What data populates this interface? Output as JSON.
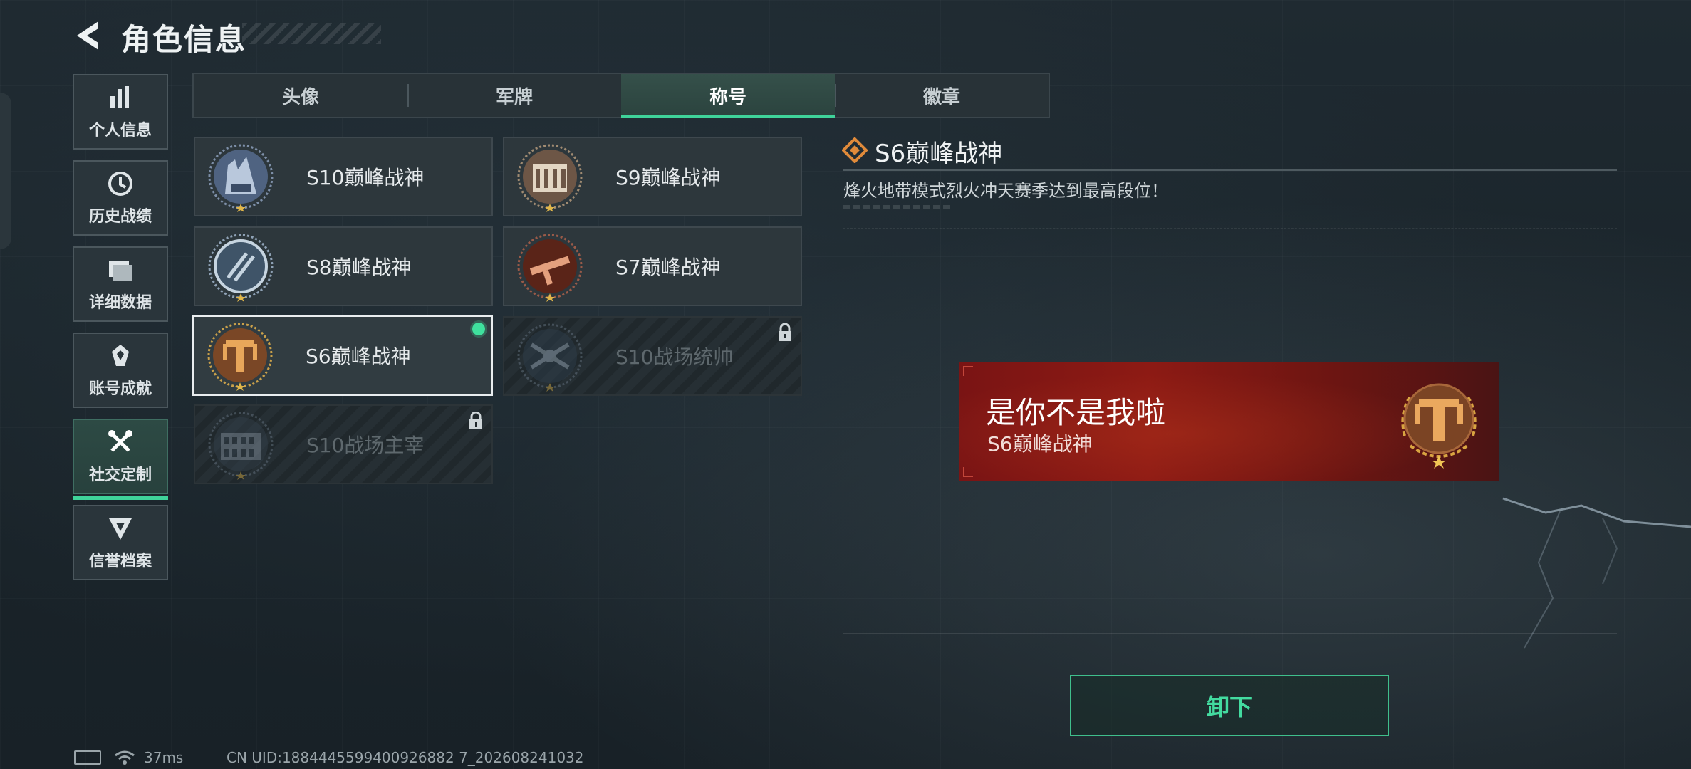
{
  "header": {
    "title": "角色信息"
  },
  "sidebar": {
    "items": [
      {
        "label": "个人信息",
        "icon": "bar-chart-icon"
      },
      {
        "label": "历史战绩",
        "icon": "history-clock-icon"
      },
      {
        "label": "详细数据",
        "icon": "folder-icon"
      },
      {
        "label": "账号成就",
        "icon": "achievement-medal-icon"
      },
      {
        "label": "社交定制",
        "icon": "tools-icon",
        "active": true
      },
      {
        "label": "信誉档案",
        "icon": "shield-badge-icon"
      }
    ]
  },
  "tabs": [
    {
      "label": "头像"
    },
    {
      "label": "军牌"
    },
    {
      "label": "称号",
      "active": true
    },
    {
      "label": "徽章"
    }
  ],
  "titles": [
    {
      "name": "S10巅峰战神",
      "emblem": "building-emblem-icon"
    },
    {
      "name": "S9巅峰战神",
      "emblem": "facade-emblem-icon"
    },
    {
      "name": "S8巅峰战神",
      "emblem": "stripes-emblem-icon"
    },
    {
      "name": "S7巅峰战神",
      "emblem": "gun-emblem-icon"
    },
    {
      "name": "S6巅峰战神",
      "emblem": "t-emblem-icon",
      "selected": true,
      "equipped": true
    },
    {
      "name": "S10战场统帅",
      "emblem": "drone-emblem-icon",
      "locked": true
    },
    {
      "name": "S10战场主宰",
      "emblem": "colosseum-emblem-icon",
      "locked": true
    }
  ],
  "detail": {
    "title": "S6巅峰战神",
    "description": "烽火地带模式烈火冲天赛季达到最高段位！"
  },
  "banner": {
    "player_name": "是你不是我啦",
    "title": "S6巅峰战神"
  },
  "unequip_label": "卸下",
  "status": {
    "ping": "37ms",
    "uid": "CN UID:1884445599400926882 7_202608241032"
  },
  "colors": {
    "accent": "#3fd39a",
    "banner_red": "#8d1a14",
    "gold": "#d9a441"
  }
}
